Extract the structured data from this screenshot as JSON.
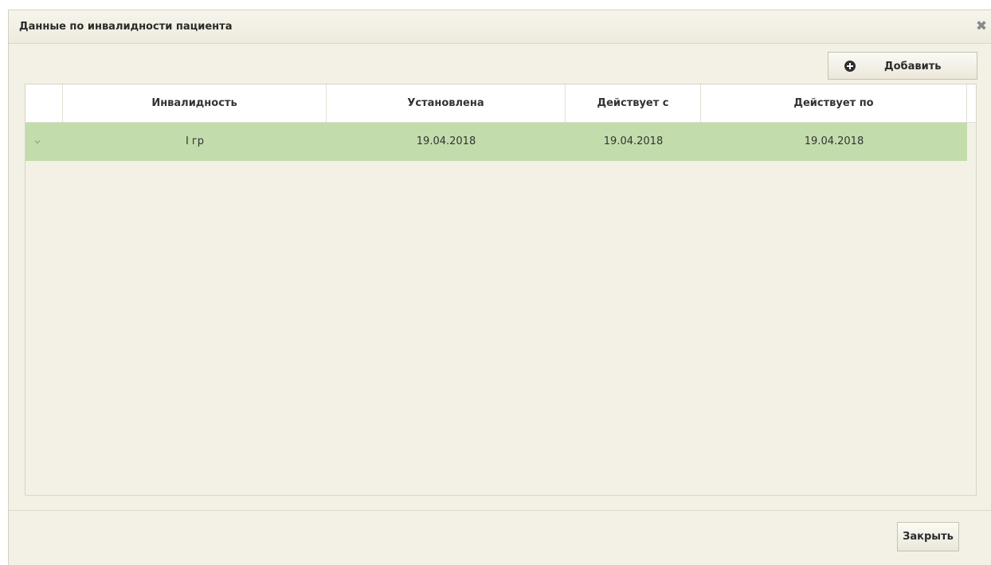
{
  "dialog": {
    "title": "Данные по инвалидности пациента",
    "close_icon": "close-icon"
  },
  "toolbar": {
    "add_label": "Добавить",
    "add_icon": "plus-circle-icon"
  },
  "table": {
    "columns": [
      "",
      "Инвалидность",
      "Установлена",
      "Действует с",
      "Действует по"
    ],
    "rows": [
      {
        "expand_icon": "chevron-down-icon",
        "disability": "I гр",
        "established": "19.04.2018",
        "valid_from": "19.04.2018",
        "valid_to": "19.04.2018"
      }
    ],
    "selected_row_color": "#c3dcac"
  },
  "footer": {
    "close_label": "Закрыть"
  }
}
